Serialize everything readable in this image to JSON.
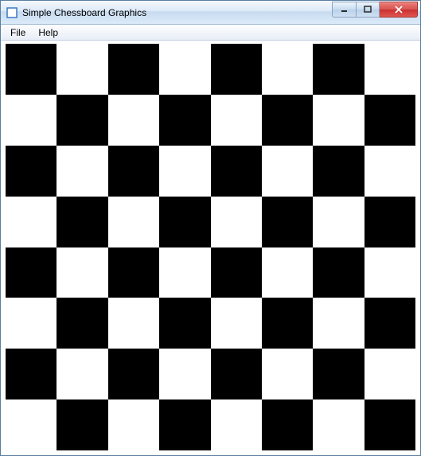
{
  "window": {
    "title": "Simple Chessboard Graphics"
  },
  "menu": {
    "file": "File",
    "help": "Help"
  },
  "board": {
    "rows": 8,
    "cols": 8,
    "colors": {
      "light": "#ffffff",
      "dark": "#000000"
    }
  }
}
